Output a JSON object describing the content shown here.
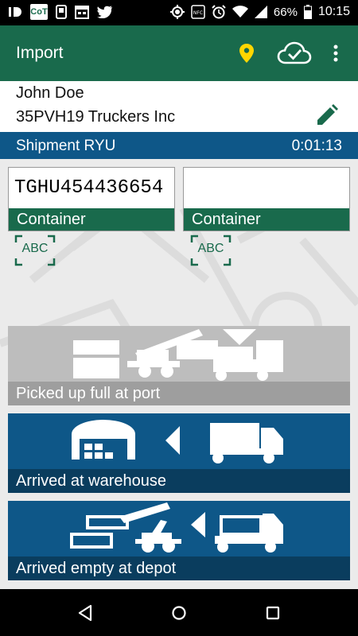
{
  "status_bar": {
    "battery": "66%",
    "time": "10:15",
    "icons": [
      "id-icon",
      "cot-app-icon",
      "phone-icon",
      "calendar-icon",
      "twitter-icon",
      "gps-icon",
      "nfc-icon",
      "alarm-icon",
      "wifi-icon",
      "signal-icon",
      "battery-icon"
    ],
    "cot_text": "CoT"
  },
  "app_bar": {
    "title": "Import",
    "icons": [
      "location-pin-icon",
      "cloud-check-icon",
      "overflow-menu-icon"
    ],
    "colors": {
      "primary": "#196a4c",
      "pin": "#ffd600"
    }
  },
  "driver": {
    "name": "John Doe",
    "company": "35PVH19 Truckers Inc",
    "edit_icon": "pencil-icon"
  },
  "shipment": {
    "label": "Shipment  RYU",
    "timer": "0:01:13",
    "color": "#0e5788"
  },
  "containers": [
    {
      "value": "TGHU454436654",
      "label": "Container",
      "scan_label": "ABC"
    },
    {
      "value": "",
      "label": "Container",
      "scan_label": "ABC"
    }
  ],
  "actions": [
    {
      "label": "Picked up full at port",
      "state": "disabled",
      "icon": "reach-stacker-to-truck-icon",
      "colors": {
        "bg": "#bdbdbd",
        "bar": "#9e9e9e"
      }
    },
    {
      "label": "Arrived at warehouse",
      "state": "enabled",
      "icon": "truck-to-warehouse-icon",
      "colors": {
        "bg": "#0e5788",
        "bar": "#0a3d5e"
      }
    },
    {
      "label": "Arrived empty at depot",
      "state": "enabled",
      "icon": "truck-to-depot-icon",
      "colors": {
        "bg": "#0e5788",
        "bar": "#0a3d5e"
      }
    }
  ],
  "nav_bar": {
    "icons": [
      "back-icon",
      "home-icon",
      "recents-icon"
    ]
  }
}
